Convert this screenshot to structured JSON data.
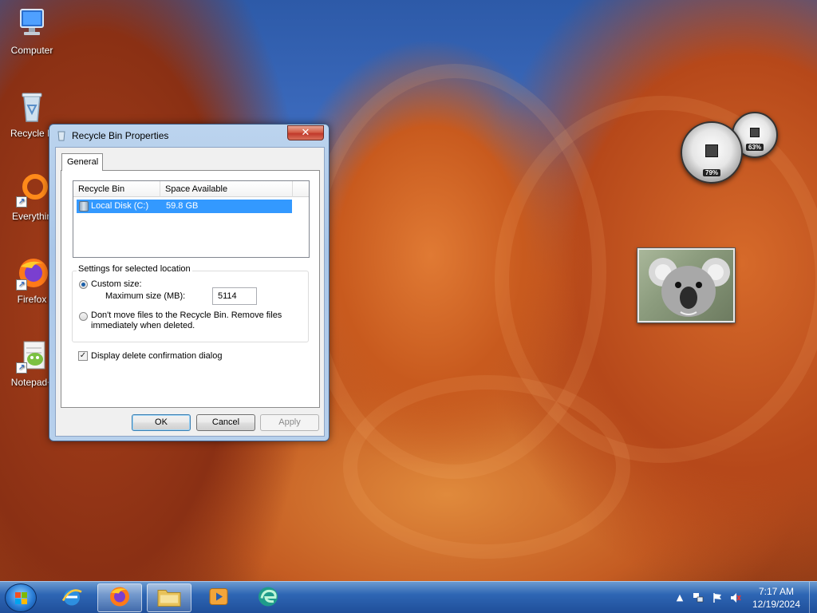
{
  "desktop": {
    "icons": [
      {
        "label": "Computer"
      },
      {
        "label": "Recycle B"
      },
      {
        "label": "Everythin"
      },
      {
        "label": "Firefox"
      },
      {
        "label": "Notepad+"
      }
    ]
  },
  "dialog": {
    "title": "Recycle Bin Properties",
    "close_label": "✕",
    "tab_general": "General",
    "columns": [
      "Recycle Bin Location",
      "Space Available"
    ],
    "rows": [
      {
        "location": "Local Disk (C:)",
        "space": "59.8 GB"
      }
    ],
    "settings_group_title": "Settings for selected location",
    "custom_size_label": "Custom size:",
    "max_size_label": "Maximum size (MB):",
    "max_size_value": "5114",
    "dont_move_label_line1": "Don't move files to the Recycle Bin. Remove files",
    "dont_move_label_line2": "immediately when deleted.",
    "display_confirm_label": "Display delete confirmation dialog",
    "ok_label": "OK",
    "cancel_label": "Cancel",
    "apply_label": "Apply"
  },
  "gadgets": {
    "cpu_value": "79%",
    "memory_value": "63%"
  },
  "taskbar": {
    "time": "7:17 AM",
    "date": "12/19/2024",
    "pinned": [
      "internet-explorer-icon",
      "firefox-icon",
      "file-explorer-icon",
      "media-player-icon",
      "edge-icon"
    ]
  },
  "colors": {
    "selection": "#3399ff",
    "taskbar": "#2e66b4",
    "close_button": "#c0392b"
  }
}
